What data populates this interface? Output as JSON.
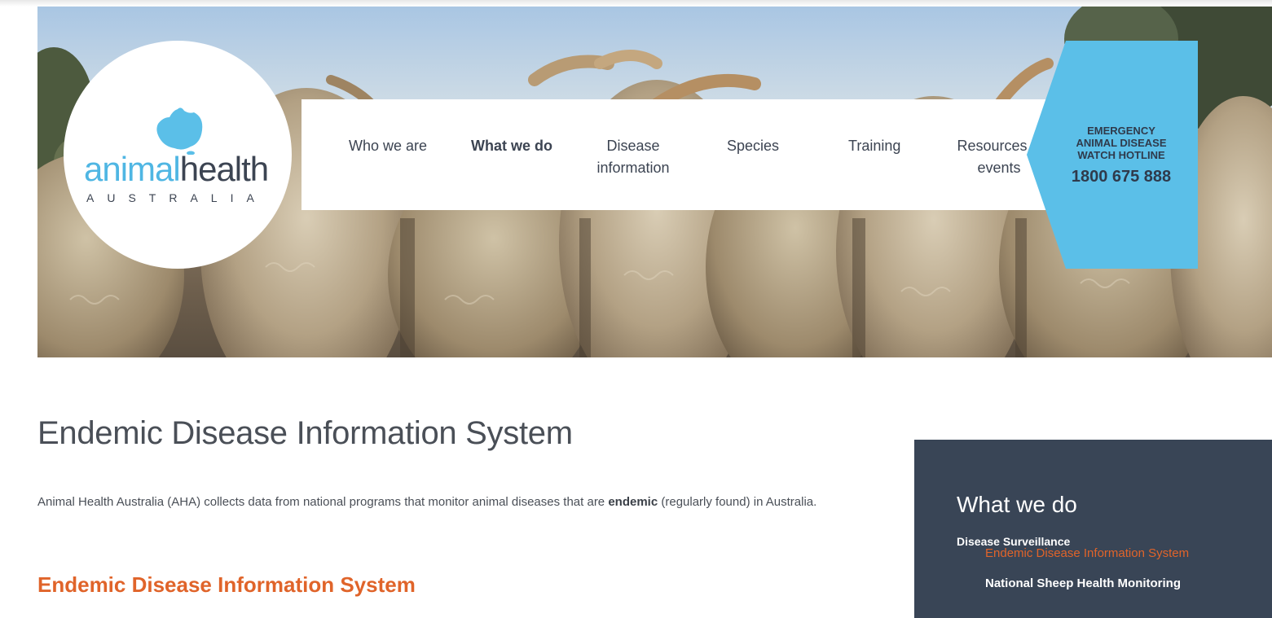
{
  "logo": {
    "word_light": "animal",
    "word_dark": "health",
    "subtitle": "AUSTRALIA"
  },
  "nav": {
    "items": [
      {
        "label": "Who we are",
        "active": false
      },
      {
        "label": "What we do",
        "active": true
      },
      {
        "label": "Disease information",
        "active": false
      },
      {
        "label": "Species",
        "active": false
      },
      {
        "label": "Training",
        "active": false
      },
      {
        "label": "Resources & events",
        "active": false
      }
    ]
  },
  "hotline": {
    "line1": "EMERGENCY",
    "line2": "ANIMAL DISEASE",
    "line3": "WATCH HOTLINE",
    "number": "1800 675 888"
  },
  "main": {
    "title": "Endemic Disease Information System",
    "intro_before": "Animal Health Australia (AHA) collects data from national programs that monitor animal diseases that are ",
    "intro_bold": "endemic",
    "intro_after": " (regularly found) in Australia.",
    "section_heading": "Endemic Disease Information System"
  },
  "sidebar": {
    "title": "What we do",
    "group": "Disease Surveillance",
    "links": [
      {
        "label": "Endemic Disease Information System",
        "current": true
      },
      {
        "label": "National Sheep Health Monitoring",
        "current": false
      }
    ]
  },
  "colors": {
    "accent_orange": "#e0642a",
    "brand_blue": "#4fb6e3",
    "hotline_blue": "#5bbfe8",
    "sidebar_bg": "#394556",
    "text_dark": "#3c4452"
  }
}
